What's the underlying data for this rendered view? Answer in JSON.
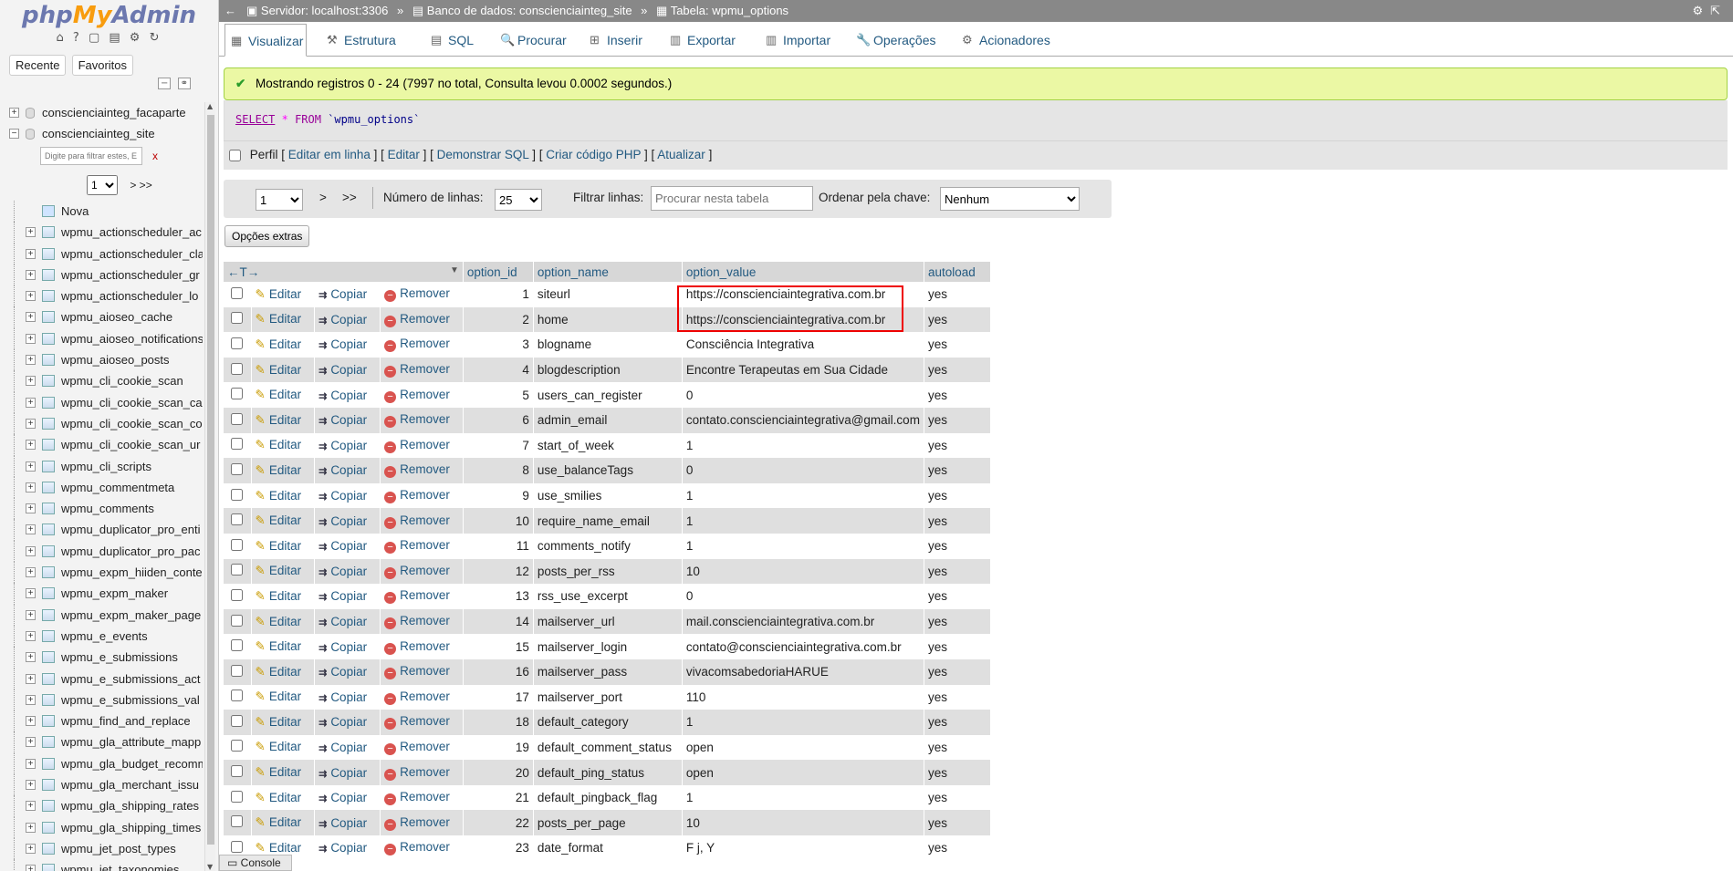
{
  "app": {
    "logo_php": "php",
    "logo_my": "My",
    "logo_admin": "Admin",
    "quick_icons": "⌂ ? ▢ ▤ ⚙ ↻"
  },
  "sidebar": {
    "tabs": [
      "Recente",
      "Favoritos"
    ],
    "databases": [
      {
        "name": "conscienciainteg_facaparte",
        "expander": "+"
      },
      {
        "name": "conscienciainteg_site",
        "expander": "−"
      }
    ],
    "filter_placeholder": "Digite para filtrar estes, E",
    "filter_clear": "x",
    "page_select": "1",
    "page_next": "> >>",
    "new_label": "Nova",
    "tables": [
      "wpmu_actionscheduler_ac",
      "wpmu_actionscheduler_cla",
      "wpmu_actionscheduler_gr",
      "wpmu_actionscheduler_lo",
      "wpmu_aioseo_cache",
      "wpmu_aioseo_notifications",
      "wpmu_aioseo_posts",
      "wpmu_cli_cookie_scan",
      "wpmu_cli_cookie_scan_ca",
      "wpmu_cli_cookie_scan_co",
      "wpmu_cli_cookie_scan_ur",
      "wpmu_cli_scripts",
      "wpmu_commentmeta",
      "wpmu_comments",
      "wpmu_duplicator_pro_enti",
      "wpmu_duplicator_pro_pac",
      "wpmu_expm_hiiden_conte",
      "wpmu_expm_maker",
      "wpmu_expm_maker_page",
      "wpmu_e_events",
      "wpmu_e_submissions",
      "wpmu_e_submissions_act",
      "wpmu_e_submissions_val",
      "wpmu_find_and_replace",
      "wpmu_gla_attribute_mapp",
      "wpmu_gla_budget_recomm",
      "wpmu_gla_merchant_issu",
      "wpmu_gla_shipping_rates",
      "wpmu_gla_shipping_times",
      "wpmu_jet_post_types",
      "wpmu_jet_taxonomies"
    ]
  },
  "topbar": {
    "server": "Servidor: localhost:3306",
    "database": "Banco de dados: conscienciainteg_site",
    "table": "Tabela: wpmu_options",
    "separator": "»"
  },
  "tabs": [
    {
      "label": "Visualizar",
      "icon": "▦"
    },
    {
      "label": "Estrutura",
      "icon": "⚒"
    },
    {
      "label": "SQL",
      "icon": "▤"
    },
    {
      "label": "Procurar",
      "icon": "🔍"
    },
    {
      "label": "Inserir",
      "icon": "⊞"
    },
    {
      "label": "Exportar",
      "icon": "▥"
    },
    {
      "label": "Importar",
      "icon": "▥"
    },
    {
      "label": "Operações",
      "icon": "🔧"
    },
    {
      "label": "Acionadores",
      "icon": "⚙"
    }
  ],
  "message": {
    "success": "Mostrando registros 0 - 24 (7997 no total, Consulta levou 0.0002 segundos.)"
  },
  "sql": {
    "select": "SELECT",
    "star": "*",
    "from": "FROM",
    "table": "`wpmu_options`"
  },
  "sql_options": {
    "profile_label": "Perfil",
    "links": [
      "Editar em linha",
      "Editar",
      "Demonstrar SQL",
      "Criar código PHP",
      "Atualizar"
    ]
  },
  "navigation": {
    "page": "1",
    "next": ">",
    "last": ">>",
    "rows_label": "Número de linhas:",
    "rows_value": "25",
    "filter_label": "Filtrar linhas:",
    "filter_placeholder": "Procurar nesta tabela",
    "sort_label": "Ordenar pela chave:",
    "sort_value": "Nenhum"
  },
  "extra_options_button": "Opções extras",
  "table": {
    "arrows": "←T→",
    "columns": [
      "option_id",
      "option_name",
      "option_value",
      "autoload"
    ],
    "actions": {
      "edit": "Editar",
      "copy": "Copiar",
      "remove": "Remover"
    },
    "rows": [
      {
        "id": "1",
        "name": "siteurl",
        "value": "https://conscienciaintegrativa.com.br",
        "autoload": "yes"
      },
      {
        "id": "2",
        "name": "home",
        "value": "https://conscienciaintegrativa.com.br",
        "autoload": "yes"
      },
      {
        "id": "3",
        "name": "blogname",
        "value": "Consciência Integrativa",
        "autoload": "yes"
      },
      {
        "id": "4",
        "name": "blogdescription",
        "value": "Encontre Terapeutas em Sua Cidade",
        "autoload": "yes"
      },
      {
        "id": "5",
        "name": "users_can_register",
        "value": "0",
        "autoload": "yes"
      },
      {
        "id": "6",
        "name": "admin_email",
        "value": "contato.conscienciaintegrativa@gmail.com",
        "autoload": "yes"
      },
      {
        "id": "7",
        "name": "start_of_week",
        "value": "1",
        "autoload": "yes"
      },
      {
        "id": "8",
        "name": "use_balanceTags",
        "value": "0",
        "autoload": "yes"
      },
      {
        "id": "9",
        "name": "use_smilies",
        "value": "1",
        "autoload": "yes"
      },
      {
        "id": "10",
        "name": "require_name_email",
        "value": "1",
        "autoload": "yes"
      },
      {
        "id": "11",
        "name": "comments_notify",
        "value": "1",
        "autoload": "yes"
      },
      {
        "id": "12",
        "name": "posts_per_rss",
        "value": "10",
        "autoload": "yes"
      },
      {
        "id": "13",
        "name": "rss_use_excerpt",
        "value": "0",
        "autoload": "yes"
      },
      {
        "id": "14",
        "name": "mailserver_url",
        "value": "mail.conscienciaintegrativa.com.br",
        "autoload": "yes"
      },
      {
        "id": "15",
        "name": "mailserver_login",
        "value": "contato@conscienciaintegrativa.com.br",
        "autoload": "yes"
      },
      {
        "id": "16",
        "name": "mailserver_pass",
        "value": "vivacomsabedoriaHARUE",
        "autoload": "yes"
      },
      {
        "id": "17",
        "name": "mailserver_port",
        "value": "110",
        "autoload": "yes"
      },
      {
        "id": "18",
        "name": "default_category",
        "value": "1",
        "autoload": "yes"
      },
      {
        "id": "19",
        "name": "default_comment_status",
        "value": "open",
        "autoload": "yes"
      },
      {
        "id": "20",
        "name": "default_ping_status",
        "value": "open",
        "autoload": "yes"
      },
      {
        "id": "21",
        "name": "default_pingback_flag",
        "value": "1",
        "autoload": "yes"
      },
      {
        "id": "22",
        "name": "posts_per_page",
        "value": "10",
        "autoload": "yes"
      },
      {
        "id": "23",
        "name": "date_format",
        "value": "F j, Y",
        "autoload": "yes"
      }
    ]
  },
  "console_label": "Console",
  "colors": {
    "link": "#235a81",
    "success_bg": "#ebf8a4",
    "highlight": "#e00000"
  }
}
